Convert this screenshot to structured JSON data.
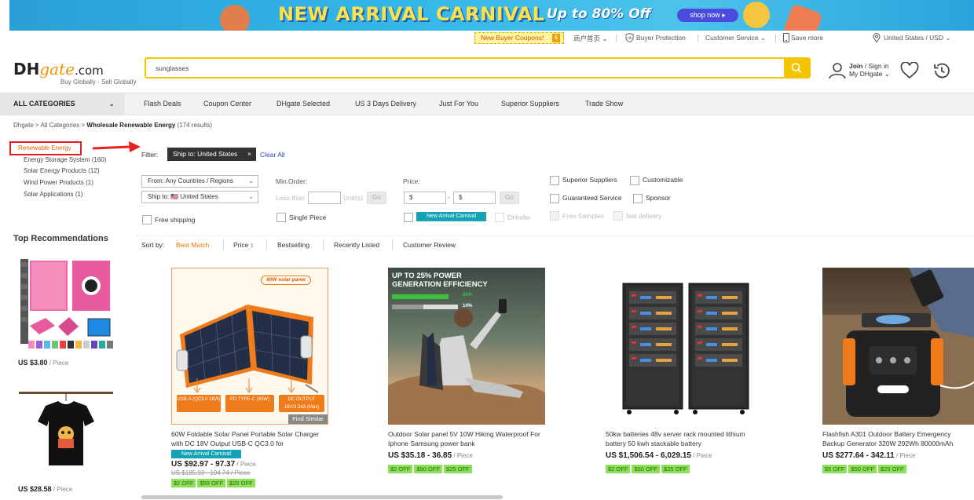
{
  "banner": {
    "title": "NEW ARRIVAL CARNIVAL",
    "subtitle": "Up to 80% Off",
    "button": "shop now ▸"
  },
  "utility": {
    "coupon": "New Buyer Coupons!",
    "coupon_icon": "$",
    "home_cn": "商户首页 ⌄",
    "buyer_protection": "Buyer Protection",
    "customer_service": "Customer Service ⌄",
    "save_more": "Save more",
    "region": "United States / USD ⌄"
  },
  "header": {
    "logo_dh": "DH",
    "logo_gate": "gate",
    "logo_com": ".com",
    "tagline": "Buy Globally · Sell Globally",
    "search_value": "sunglasses",
    "join_line1": "Join",
    "join_sep": " / Sign in",
    "join_line2": "My DHgate ⌄"
  },
  "nav": {
    "all_categories": "ALL CATEGORIES",
    "items": [
      "Flash Deals",
      "Coupon Center",
      "DHgate Selected",
      "US 3 Days Delivery",
      "Just For You",
      "Superior Suppliers",
      "Trade Show"
    ]
  },
  "breadcrumb": {
    "path": "Dhgate > All Categories > ",
    "current": "Wholesale Renewable Energy",
    "count": " (174 results)"
  },
  "sidebar": {
    "active": "Renewable Energy",
    "items": [
      "Energy Storage System (160)",
      "Solar Energy Products (12)",
      "Wind Power Products (1)",
      "Solar Applications (1)"
    ],
    "recommendations_title": "Top Recommendations",
    "rec": [
      {
        "price": "US $3.80",
        "unit": " / Piece"
      },
      {
        "price": "US $28.58",
        "unit": " / Piece"
      }
    ]
  },
  "filters": {
    "label": "Filter:",
    "chip": "Ship to: United States",
    "chip_close": "×",
    "clear_all": "Clear All",
    "from": "From: Any Countries / Regions",
    "ship_to": "Ship to: 🇺🇸 United States",
    "free_shipping": "Free shipping",
    "min_order": "Min.Order:",
    "less_than": "Less than",
    "units": "Unit(s)",
    "go": "Go",
    "single_piece": "Single Piece",
    "price": "Price:",
    "price_from": "$",
    "price_dash": "-",
    "price_to": "$",
    "new_arrival": "New Arrival Carnival",
    "dhrefer": "DHrefer",
    "superior_suppliers": "Superior Suppliers",
    "customizable": "Customizable",
    "guaranteed_service": "Guaranteed Service",
    "sponsor": "Sponsor",
    "free_samples": "Free Samples",
    "fast_delivery": "fast delivery"
  },
  "sort": {
    "label": "Sort by:",
    "options": [
      "Best Match",
      "Price ↕",
      "Bestselling",
      "Recently Listed",
      "Customer Review"
    ]
  },
  "products": [
    {
      "title": "60W Foldable Solar Panel Portable Solar Charger with DC 18V Output USB-C QC3.0 for",
      "badge": "New Arrival Carnival",
      "price": "US $92.97 - 97.37",
      "unit": " / Piece",
      "old_price": "US $185.93 - 194.74 / Piece",
      "tags": [
        "$2 OFF",
        "$50 OFF",
        "$25 OFF"
      ],
      "img_label": "60W solar panel",
      "find_similar": "Find Similar",
      "ports": [
        "USB-A (QC3.0 18W)",
        "PD TYPE-C (45W)",
        "DC OUTPUT 18V/3.34A (Max)"
      ]
    },
    {
      "title": "Outdoor Solar panel 5V 10W Hiking Waterproof For Iphone Samsung power bank",
      "price": "US $35.18 - 36.85",
      "unit": " / Piece",
      "tags": [
        "$2 OFF",
        "$50 OFF",
        "$25 OFF"
      ],
      "img_line1": "UP TO 25% POWER",
      "img_line2": "GENERATION EFFICIENCY",
      "img_pct1": "26%",
      "img_pct2": "14%"
    },
    {
      "title": "50kw batteries 48v server rack mounted lithium battery 50 kwh stackable battery",
      "price": "US $1,506.54 - 6,029.15",
      "unit": " / Piece",
      "tags": [
        "$2 OFF",
        "$50 OFF",
        "$25 OFF"
      ]
    },
    {
      "title": "Flashfish A301 Outdoor Battery Emergency Backup Generator 320W 292Wh 80000mAh",
      "price": "US $277.64 - 342.11",
      "unit": " / Piece",
      "tags": [
        "$5 OFF",
        "$50 OFF",
        "$25 OFF"
      ]
    }
  ]
}
